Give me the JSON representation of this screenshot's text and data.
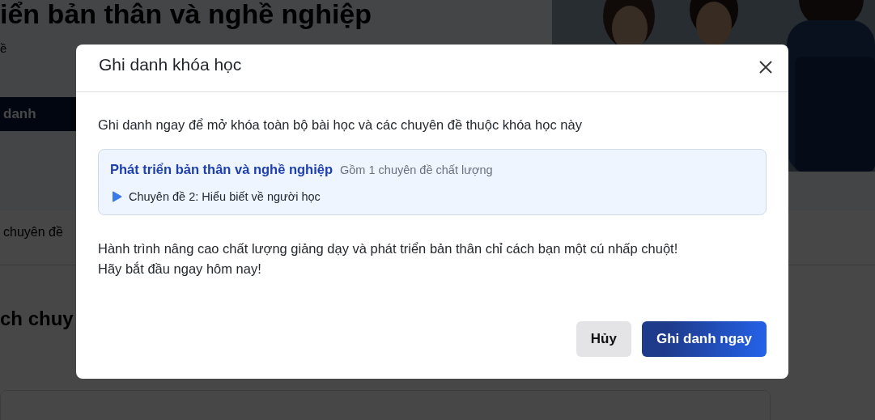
{
  "page": {
    "heading": "iển bản thân và nghề nghiệp",
    "meta": "ề",
    "enroll_button": "danh",
    "tab": "chuyên đề",
    "section_heading": "ch chuy"
  },
  "dialog": {
    "title": "Ghi danh khóa học",
    "intro": "Ghi danh ngay để mở khóa toàn bộ bài học và các chuyên đề thuộc khóa học này",
    "course": {
      "title": "Phát triển bản thân và nghề nghiệp",
      "summary": "Gồm 1 chuyên đề chất lượng",
      "topics": [
        "Chuyên đề 2: Hiểu biết về người học"
      ]
    },
    "message": "Hành trình nâng cao chất lượng giảng dạy và phát triển bản thân chỉ cách bạn một cú nhấp chuột!\nHãy bắt đầu ngay hôm nay!",
    "buttons": [
      {
        "label": "Hủy",
        "kind": "secondary"
      },
      {
        "label": "Ghi danh ngay",
        "kind": "primary"
      }
    ]
  }
}
